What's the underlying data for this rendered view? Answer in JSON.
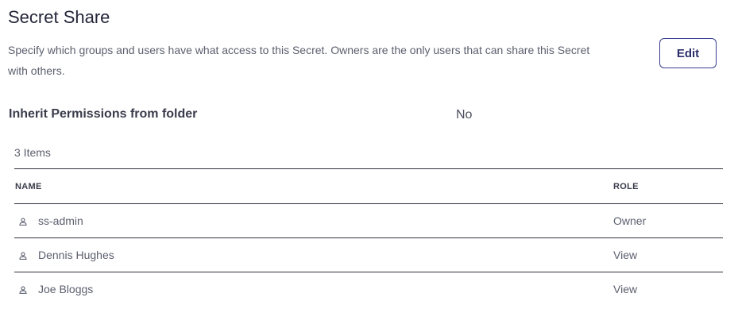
{
  "header": {
    "title": "Secret Share",
    "description": "Specify which groups and users have what access to this Secret. Owners are the only users that can share this Secret with others.",
    "edit_label": "Edit"
  },
  "inherit": {
    "label": "Inherit Permissions from folder",
    "value": "No"
  },
  "items_count": "3 Items",
  "table": {
    "columns": [
      "NAME",
      "ROLE"
    ],
    "rows": [
      {
        "icon": "user-icon",
        "name": "ss-admin",
        "role": "Owner"
      },
      {
        "icon": "user-icon",
        "name": "Dennis Hughes",
        "role": "View"
      },
      {
        "icon": "user-icon",
        "name": "Joe Bloggs",
        "role": "View"
      }
    ]
  }
}
